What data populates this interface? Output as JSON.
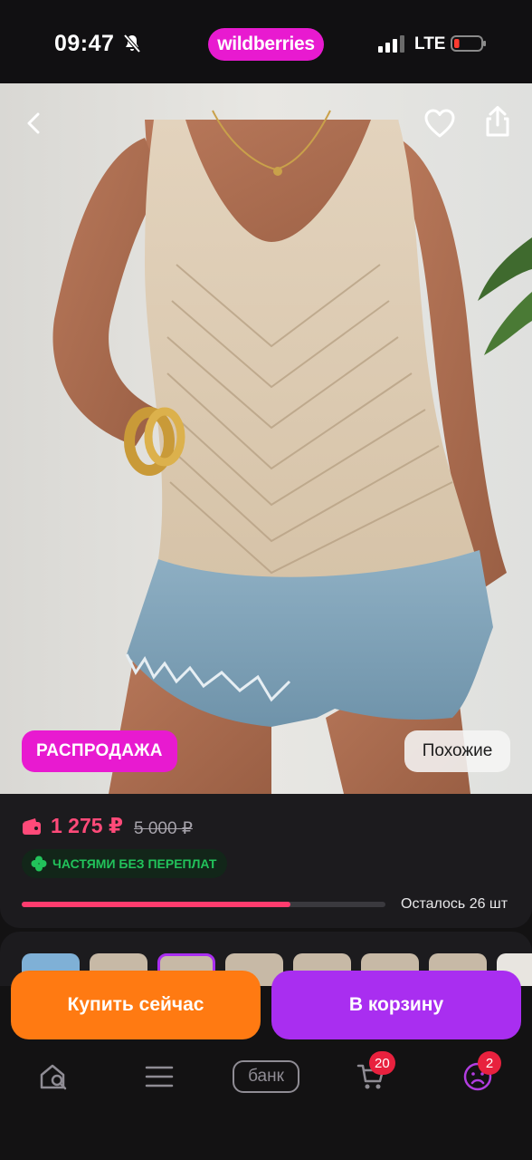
{
  "status_bar": {
    "time": "09:47",
    "brand": "wildberries",
    "network": "LTE",
    "brand_color": "#e81ad0",
    "battery_level": 0.1
  },
  "product": {
    "image_description_icons": [
      "back-icon",
      "heart-icon",
      "share-icon"
    ],
    "sale_badge": "РАСПРОДАЖА",
    "similar_button": "Похожие",
    "price": "1 275 ₽",
    "old_price": "5 000 ₽",
    "installment_label": "ЧАСТЯМИ БЕЗ ПЕРЕПЛАТ",
    "stock_text": "Осталось 26 шт",
    "stock_fraction": 0.74,
    "price_color": "#ff4a79"
  },
  "actions": {
    "buy_now": "Купить сейчас",
    "add_to_cart": "В корзину",
    "buy_color": "#ff7a12",
    "cart_color": "#a92ef0"
  },
  "bottom_nav": {
    "items": [
      {
        "icon": "home-search-icon"
      },
      {
        "icon": "menu-icon"
      },
      {
        "icon": "bank-icon",
        "label": "банк"
      },
      {
        "icon": "cart-icon",
        "badge": "20"
      },
      {
        "icon": "profile-icon",
        "badge": "2"
      }
    ]
  }
}
